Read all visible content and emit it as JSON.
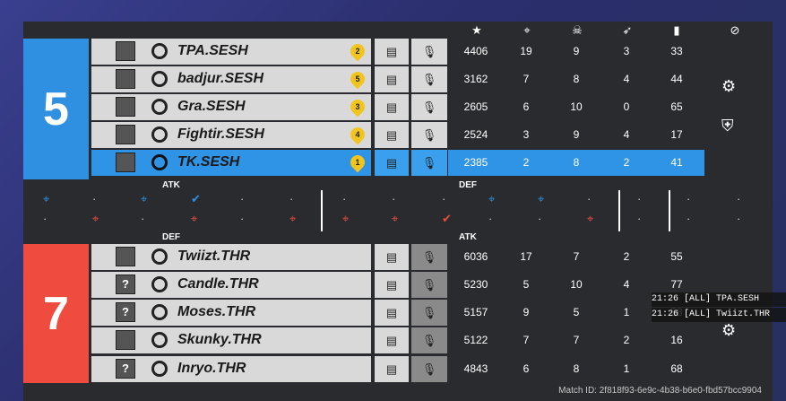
{
  "header_icons": [
    "star-icon",
    "crosshair-icon",
    "skull-icon",
    "assist-icon",
    "ping-icon",
    "ban-icon"
  ],
  "blue_team": {
    "score": "5",
    "players": [
      {
        "name": "TPA.SESH",
        "rank": "2",
        "score": "4406",
        "kills": "19",
        "deaths": "9",
        "assists": "3",
        "ping": "33"
      },
      {
        "name": "badjur.SESH",
        "rank": "5",
        "score": "3162",
        "kills": "7",
        "deaths": "8",
        "assists": "4",
        "ping": "44"
      },
      {
        "name": "Gra.SESH",
        "rank": "3",
        "score": "2605",
        "kills": "6",
        "deaths": "10",
        "assists": "0",
        "ping": "65"
      },
      {
        "name": "Fightir.SESH",
        "rank": "4",
        "score": "2524",
        "kills": "3",
        "deaths": "9",
        "assists": "4",
        "ping": "17"
      },
      {
        "name": "TK.SESH",
        "rank": "1",
        "score": "2385",
        "kills": "2",
        "deaths": "8",
        "assists": "2",
        "ping": "41"
      }
    ]
  },
  "red_team": {
    "score": "7",
    "players": [
      {
        "name": "Twiizt.THR",
        "op": "",
        "score": "6036",
        "kills": "17",
        "deaths": "7",
        "assists": "2",
        "ping": "55"
      },
      {
        "name": "Candle.THR",
        "op": "?",
        "score": "5230",
        "kills": "5",
        "deaths": "10",
        "assists": "4",
        "ping": "77"
      },
      {
        "name": "Moses.THR",
        "op": "?",
        "score": "5157",
        "kills": "9",
        "deaths": "5",
        "assists": "1",
        "ping": "58"
      },
      {
        "name": "Skunky.THR",
        "op": "",
        "score": "5122",
        "kills": "7",
        "deaths": "7",
        "assists": "2",
        "ping": "16"
      },
      {
        "name": "Inryo.THR",
        "op": "?",
        "score": "4843",
        "kills": "6",
        "deaths": "8",
        "assists": "1",
        "ping": "68"
      }
    ]
  },
  "labels": {
    "atk_top": "ATK",
    "def_top": "DEF",
    "def_bottom": "DEF",
    "atk_bottom": "ATK"
  },
  "match_id": "Match ID: 2f818f93-6e9c-4b38-b6e0-fbd57bcc9904",
  "chat_log": [
    "21:26  [ALL] TPA.SESH",
    "21:26  [ALL] Twiizt.THR"
  ],
  "colors": {
    "blue": "#2f8fe0",
    "red": "#ef4b3f",
    "rank": "#f2c51e"
  }
}
